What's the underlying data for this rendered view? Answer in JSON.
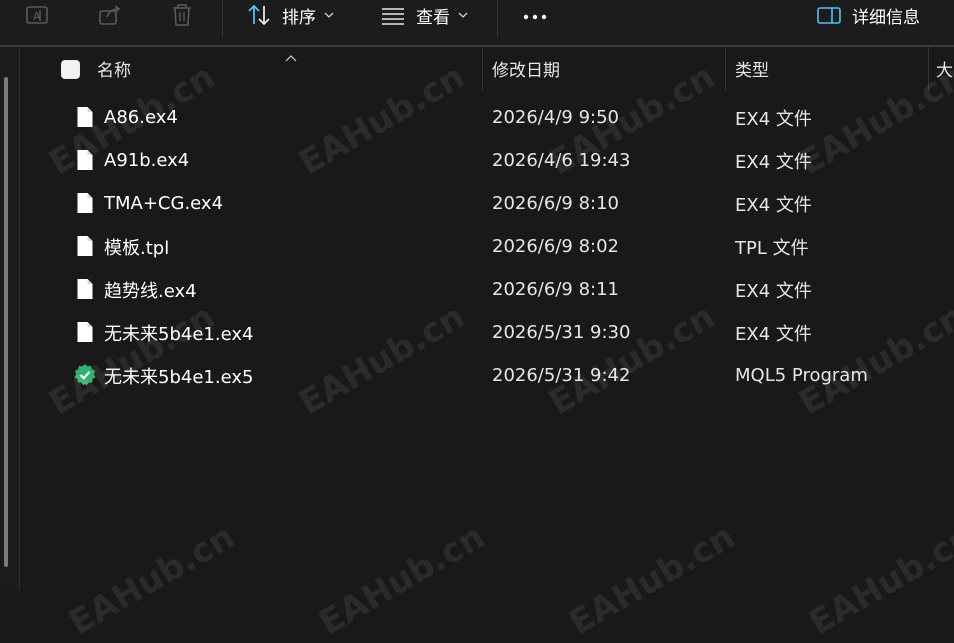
{
  "toolbar": {
    "sort_label": "排序",
    "view_label": "查看",
    "details_label": "详细信息"
  },
  "columns": {
    "name": "名称",
    "date": "修改日期",
    "type": "类型",
    "size_partial": "大"
  },
  "files": [
    {
      "name": "A86.ex4",
      "date": "2026/4/9 9:50",
      "type": "EX4 文件",
      "icon": "file-icon"
    },
    {
      "name": "A91b.ex4",
      "date": "2026/4/6 19:43",
      "type": "EX4 文件",
      "icon": "file-icon"
    },
    {
      "name": "TMA+CG.ex4",
      "date": "2026/6/9 8:10",
      "type": "EX4 文件",
      "icon": "file-icon"
    },
    {
      "name": "模板.tpl",
      "date": "2026/6/9 8:02",
      "type": "TPL 文件",
      "icon": "file-icon"
    },
    {
      "name": "趋势线.ex4",
      "date": "2026/6/9 8:11",
      "type": "EX4 文件",
      "icon": "file-icon"
    },
    {
      "name": "无未来5b4e1.ex4",
      "date": "2026/5/31 9:30",
      "type": "EX4 文件",
      "icon": "file-icon"
    },
    {
      "name": "无未来5b4e1.ex5",
      "date": "2026/5/31 9:42",
      "type": "MQL5 Program",
      "icon": "mql5-verified-icon"
    }
  ],
  "watermark": "EAHub.cn",
  "colors": {
    "background": "#191919",
    "accent": "#4cc2ff",
    "mql5_badge": "#2fb36b"
  }
}
